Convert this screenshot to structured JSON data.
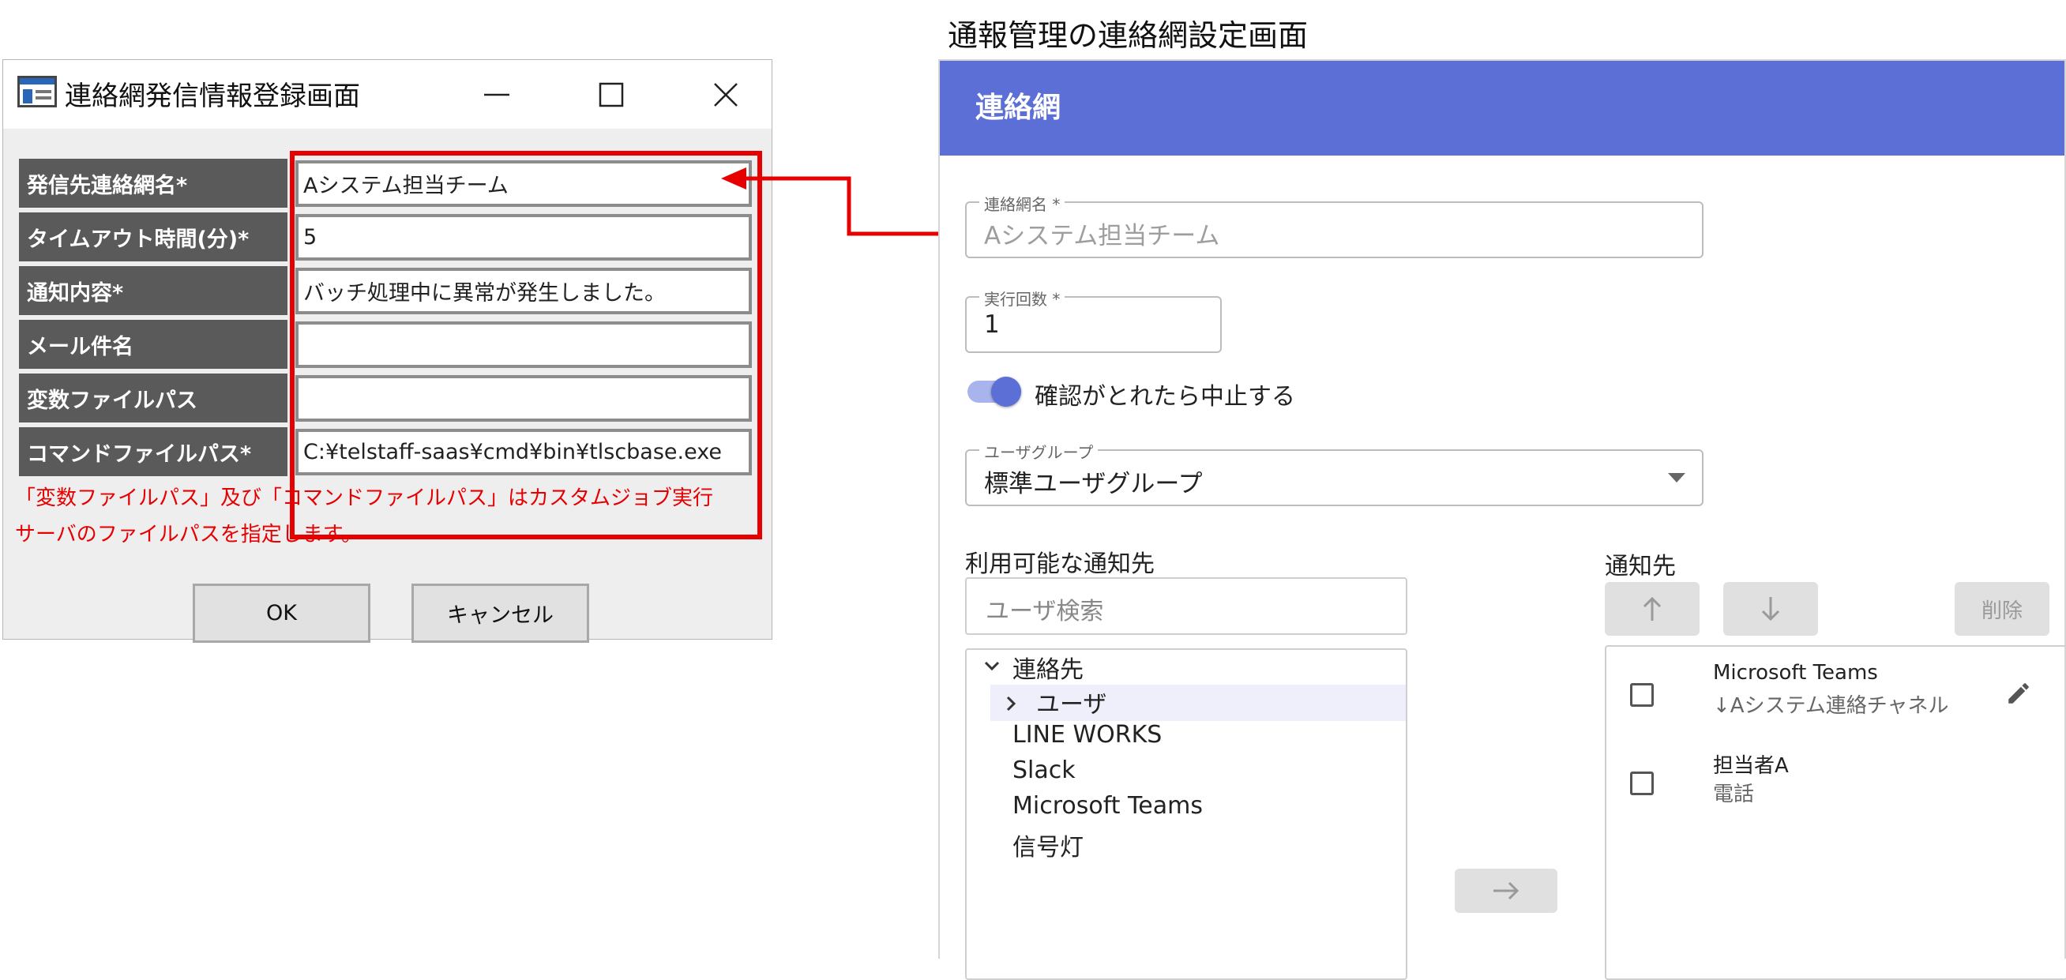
{
  "left_dialog": {
    "title": "連絡網発信情報登録画面",
    "fields": [
      {
        "label": "発信先連絡網名*",
        "value": "Aシステム担当チーム"
      },
      {
        "label": "タイムアウト時間(分)*",
        "value": "5"
      },
      {
        "label": "通知内容*",
        "value": "バッチ処理中に異常が発生しました。"
      },
      {
        "label": "メール件名",
        "value": ""
      },
      {
        "label": "変数ファイルパス",
        "value": ""
      },
      {
        "label": "コマンドファイルパス*",
        "value": "C:¥telstaff-saas¥cmd¥bin¥tlscbase.exe"
      }
    ],
    "note_line1": "「変数ファイルパス」及び「コマンドファイルパス」はカスタムジョブ実行",
    "note_line2": "サーバのファイルパスを指定します。",
    "ok_label": "OK",
    "cancel_label": "キャンセル"
  },
  "right_panel": {
    "caption": "通報管理の連絡網設定画面",
    "header_title": "連絡網",
    "name_field": {
      "label": "連絡網名 *",
      "value": "Aシステム担当チーム"
    },
    "count_field": {
      "label": "実行回数 *",
      "value": "1"
    },
    "toggle": {
      "label": "確認がとれたら中止する",
      "on": true
    },
    "group_field": {
      "label": "ユーザグループ",
      "value": "標準ユーザグループ"
    },
    "available_title": "利用可能な通知先",
    "search_placeholder": "ユーザ検索",
    "tree": {
      "root": "連絡先",
      "child": "ユーザ",
      "items": [
        "LINE WORKS",
        "Slack",
        "Microsoft Teams",
        "信号灯"
      ]
    },
    "dest_title": "通知先",
    "delete_label": "削除",
    "destinations": [
      {
        "name": "Microsoft Teams",
        "sub": "↓Aシステム連絡チャネル"
      },
      {
        "name": "担当者A",
        "sub": "電話"
      }
    ]
  },
  "colors": {
    "header_bg": "#5c6fd6",
    "highlight_red": "#e60000",
    "label_bg": "#5a5a5a"
  }
}
